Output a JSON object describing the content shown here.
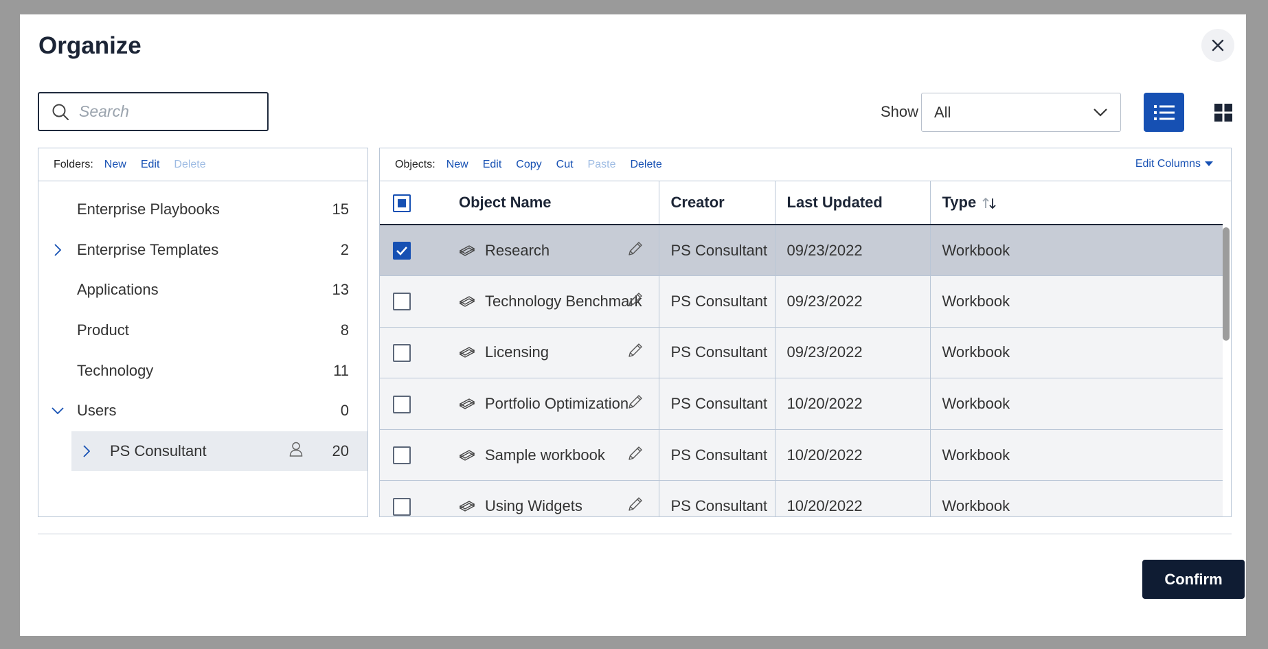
{
  "dialog": {
    "title": "Organize",
    "confirm_label": "Confirm"
  },
  "search": {
    "placeholder": "Search"
  },
  "filter": {
    "show_label": "Show",
    "show_value": "All"
  },
  "folders_toolbar": {
    "label": "Folders:",
    "new": "New",
    "edit": "Edit",
    "delete": "Delete"
  },
  "folders": [
    {
      "name": "Enterprise Playbooks",
      "count": "15"
    },
    {
      "name": "Enterprise Templates",
      "count": "2"
    },
    {
      "name": "Applications",
      "count": "13"
    },
    {
      "name": "Product",
      "count": "8"
    },
    {
      "name": "Technology",
      "count": "11"
    },
    {
      "name": "Users",
      "count": "0"
    },
    {
      "name": "PS Consultant",
      "count": "20"
    }
  ],
  "objects_toolbar": {
    "label": "Objects:",
    "new": "New",
    "edit": "Edit",
    "copy": "Copy",
    "cut": "Cut",
    "paste": "Paste",
    "delete": "Delete",
    "edit_columns": "Edit Columns"
  },
  "table": {
    "headers": [
      "Object Name",
      "Creator",
      "Last Updated",
      "Type"
    ],
    "rows": [
      {
        "name": "Research",
        "creator": "PS Consultant",
        "updated": "09/23/2022",
        "type": "Workbook",
        "checked": true
      },
      {
        "name": "Technology Benchmark",
        "creator": "PS Consultant",
        "updated": "09/23/2022",
        "type": "Workbook",
        "checked": false
      },
      {
        "name": "Licensing",
        "creator": "PS Consultant",
        "updated": "09/23/2022",
        "type": "Workbook",
        "checked": false
      },
      {
        "name": "Portfolio Optimization",
        "creator": "PS Consultant",
        "updated": "10/20/2022",
        "type": "Workbook",
        "checked": false
      },
      {
        "name": "Sample workbook",
        "creator": "PS Consultant",
        "updated": "10/20/2022",
        "type": "Workbook",
        "checked": false
      },
      {
        "name": "Using Widgets",
        "creator": "PS Consultant",
        "updated": "10/20/2022",
        "type": "Workbook",
        "checked": false
      }
    ]
  },
  "colors": {
    "accent": "#1650b3",
    "confirm_bg": "#0f1c33",
    "selected_row": "#c7ccd6"
  }
}
